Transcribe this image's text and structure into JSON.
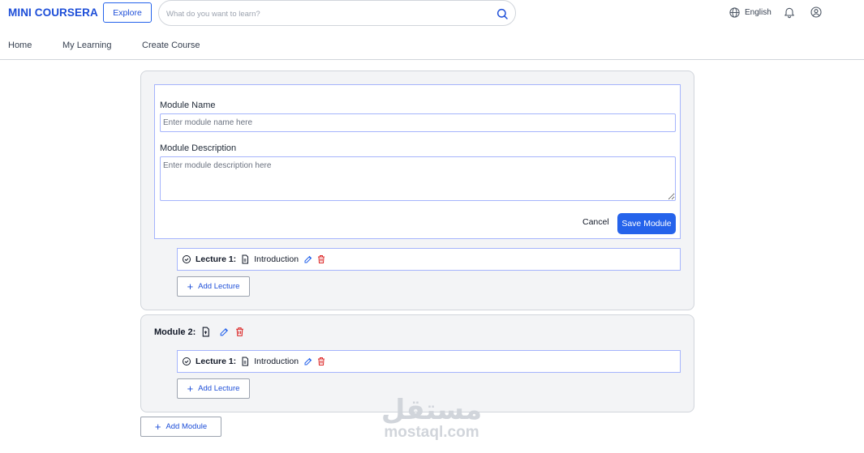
{
  "header": {
    "logo": "MINI COURSERA",
    "explore_label": "Explore",
    "search_placeholder": "What do you want to learn?",
    "language": "English"
  },
  "nav": {
    "items": [
      "Home",
      "My Learning",
      "Create Course"
    ]
  },
  "module_form": {
    "name_label": "Module Name",
    "name_placeholder": "Enter module name here",
    "description_label": "Module Description",
    "description_placeholder": "Enter module description here",
    "cancel_label": "Cancel",
    "save_label": "Save Module"
  },
  "module1": {
    "lectures": [
      {
        "number_label": "Lecture 1:",
        "title": "Introduction"
      }
    ],
    "add_lecture_label": "Add Lecture"
  },
  "module2": {
    "title": "Module 2:",
    "lectures": [
      {
        "number_label": "Lecture 1:",
        "title": "Introduction"
      }
    ],
    "add_lecture_label": "Add Lecture"
  },
  "add_module_label": "Add Module",
  "watermark": {
    "arabic": "مستقل",
    "domain": "mostaql.com"
  },
  "colors": {
    "primary": "#2563eb",
    "brand": "#1d4ed8",
    "danger": "#dc2626",
    "card_bg": "#f3f4f6",
    "input_border": "#a5b4fc"
  }
}
